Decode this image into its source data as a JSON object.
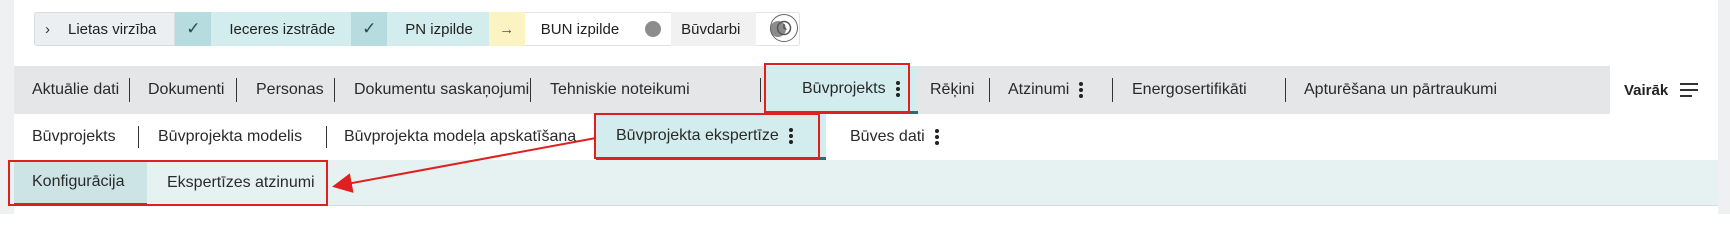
{
  "stage_bar": {
    "toggle_label": "Lietas virzība",
    "stages": [
      {
        "label": "Ieceres izstrāde",
        "status": "done"
      },
      {
        "label": "PN izpilde",
        "status": "done"
      },
      {
        "label": "BUN izpilde",
        "status": "current"
      },
      {
        "label": "Būvdarbi",
        "status": "pending"
      }
    ]
  },
  "main_tabs": {
    "items": [
      {
        "label": "Aktuālie dati"
      },
      {
        "label": "Dokumenti"
      },
      {
        "label": "Personas"
      },
      {
        "label": "Dokumentu saskaņojumi"
      },
      {
        "label": "Tehniskie noteikumi"
      },
      {
        "label": "Būvprojekts",
        "active": true,
        "has_menu": true
      },
      {
        "label": "Rēķini"
      },
      {
        "label": "Atzinumi",
        "has_menu": true
      },
      {
        "label": "Energosertifikāti"
      },
      {
        "label": "Apturēšana un pārtraukumi"
      }
    ],
    "more_label": "Vairāk"
  },
  "sub_tabs": {
    "items": [
      {
        "label": "Būvprojekts"
      },
      {
        "label": "Būvprojekta modelis"
      },
      {
        "label": "Būvprojekta modeļa apskatīšana"
      },
      {
        "label": "Būvprojekta ekspertīze",
        "active": true,
        "has_menu": true
      },
      {
        "label": "Būves dati",
        "has_menu": true
      }
    ]
  },
  "third_tabs": {
    "items": [
      {
        "label": "Konfigurācija",
        "active": true
      },
      {
        "label": "Ekspertīzes atzinumi"
      }
    ]
  },
  "colors": {
    "accent": "#2f6c72",
    "active_tab_bg": "#d3eced",
    "annotation_red": "#e02020"
  },
  "icons": {
    "toggle": "chevron-right-icon",
    "done": "check-icon",
    "current": "arrow-right-icon",
    "pending": "circle-icon",
    "history": "history-icon",
    "menu": "kebab-icon",
    "more": "hamburger-icon"
  }
}
